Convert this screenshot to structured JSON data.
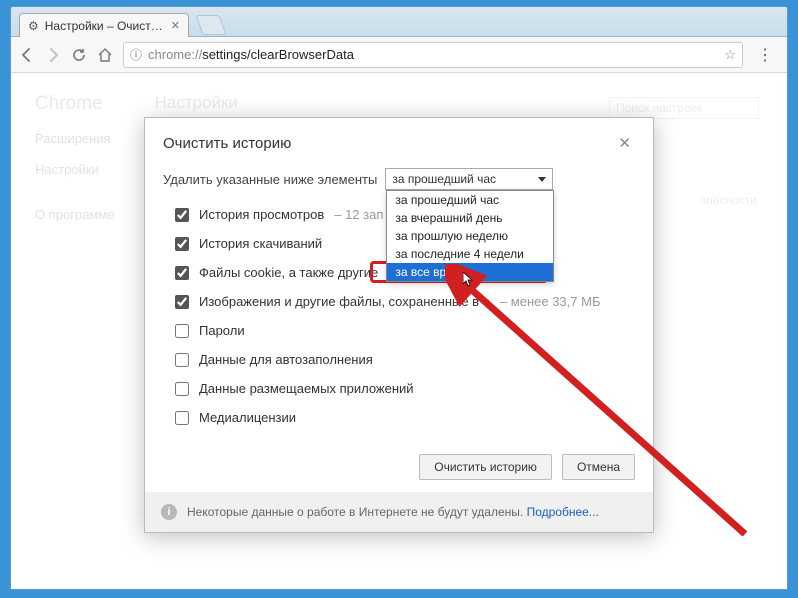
{
  "window": {
    "controls": [
      "user",
      "min",
      "max",
      "close"
    ]
  },
  "tab": {
    "title": "Настройки – Очистить"
  },
  "omnibox": {
    "prefix": "chrome://",
    "path": "settings/clearBrowserData"
  },
  "settings": {
    "brand": "Chrome",
    "nav_items": [
      "Расширения",
      "Настройки",
      "О программе"
    ],
    "heading": "Настройки",
    "search_placeholder": "Поиск настроек",
    "topbar_extra": "опасности"
  },
  "dialog": {
    "title": "Очистить историю",
    "delete_label": "Удалить указанные ниже элементы",
    "selected_option": "за прошедший час",
    "options": [
      "за прошедший час",
      "за вчерашний день",
      "за прошлую неделю",
      "за последние 4 недели",
      "за все время"
    ],
    "highlighted_index": 4,
    "checks": [
      {
        "checked": true,
        "label": "История просмотров",
        "detail": "– 12 зап"
      },
      {
        "checked": true,
        "label": "История скачиваний",
        "detail": ""
      },
      {
        "checked": true,
        "label": "Файлы cookie, а также другие",
        "detail": ""
      },
      {
        "checked": true,
        "label": "Изображения и другие файлы, сохраненные в       е",
        "detail": "– менее 33,7 МБ"
      },
      {
        "checked": false,
        "label": "Пароли",
        "detail": ""
      },
      {
        "checked": false,
        "label": "Данные для автозаполнения",
        "detail": ""
      },
      {
        "checked": false,
        "label": "Данные размещаемых приложений",
        "detail": ""
      },
      {
        "checked": false,
        "label": "Медиалицензии",
        "detail": ""
      }
    ],
    "confirm": "Очистить историю",
    "cancel": "Отмена",
    "note_text": "Некоторые данные о работе в Интернете не будут удалены.",
    "note_link": "Подробнее..."
  }
}
